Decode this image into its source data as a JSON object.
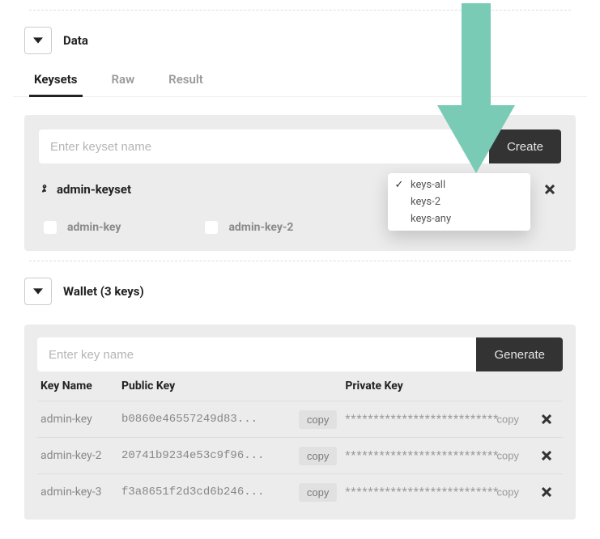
{
  "arrow_color": "#79cbb6",
  "data_section": {
    "title": "Data",
    "tabs": [
      "Keysets",
      "Raw",
      "Result"
    ],
    "active_tab": 0,
    "keyset_input_placeholder": "Enter keyset name",
    "create_label": "Create",
    "keyset": {
      "name": "admin-keyset",
      "checks": [
        "admin-key",
        "admin-key-2"
      ]
    },
    "dropdown": {
      "options": [
        "keys-all",
        "keys-2",
        "keys-any"
      ],
      "selected": 0
    }
  },
  "wallet_section": {
    "title": "Wallet (3 keys)",
    "key_input_placeholder": "Enter key name",
    "generate_label": "Generate",
    "columns": {
      "name": "Key Name",
      "public": "Public Key",
      "private": "Private Key"
    },
    "copy_label": "copy",
    "mask": "***************************",
    "rows": [
      {
        "name": "admin-key",
        "public": "b0860e46557249d83..."
      },
      {
        "name": "admin-key-2",
        "public": "20741b9234e53c9f96..."
      },
      {
        "name": "admin-key-3",
        "public": "f3a8651f2d3cd6b246..."
      }
    ]
  }
}
